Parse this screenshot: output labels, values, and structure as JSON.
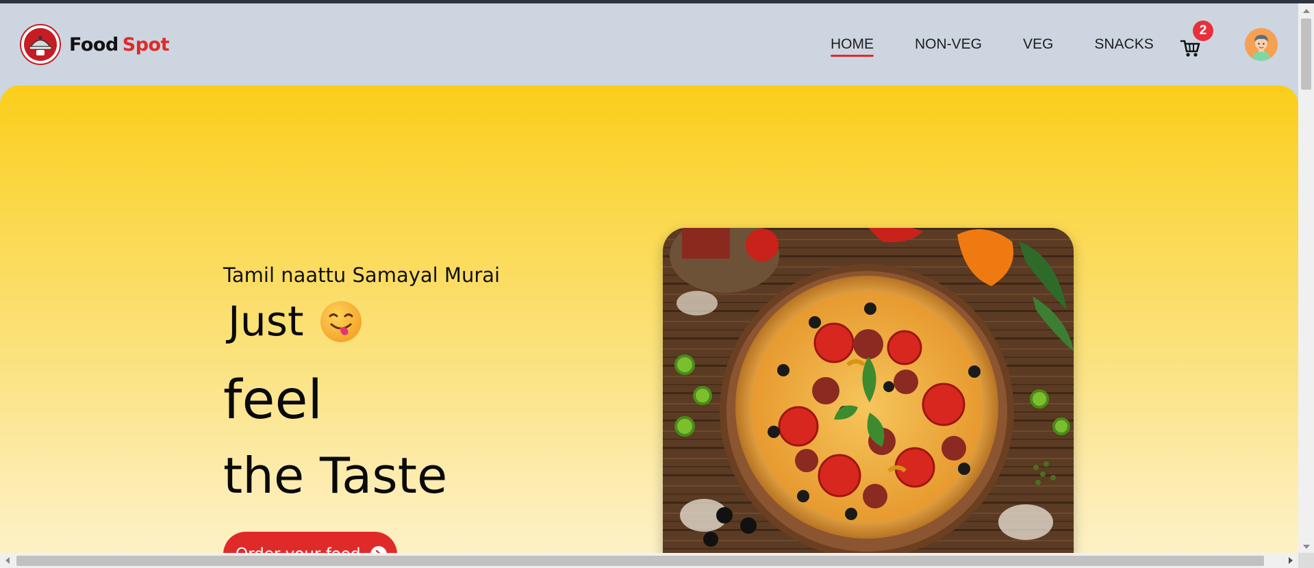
{
  "brand": {
    "name_part1": "Food",
    "name_part2": "Spot"
  },
  "nav": {
    "items": [
      {
        "label": "HOME",
        "active": true
      },
      {
        "label": "NON-VEG",
        "active": false
      },
      {
        "label": "VEG",
        "active": false
      },
      {
        "label": "SNACKS",
        "active": false
      }
    ],
    "cart_count": "2"
  },
  "hero": {
    "subtitle": "Tamil naattu Samayal Murai",
    "line1": "Just",
    "line2": "feel",
    "line3": "the Taste",
    "cta_label": "Order your food",
    "emoji": "face-savoring-food"
  },
  "icons": {
    "logo": "cloche-logo-icon",
    "cart": "shopping-cart-icon",
    "avatar": "user-avatar-icon",
    "cta_arrow": "arrow-right-circle-icon"
  },
  "colors": {
    "accent": "#e02a2a",
    "header_bg": "#cdd5e0",
    "hero_top": "#fbce1a",
    "hero_bottom": "#fdf3cc",
    "badge": "#e6313b"
  }
}
